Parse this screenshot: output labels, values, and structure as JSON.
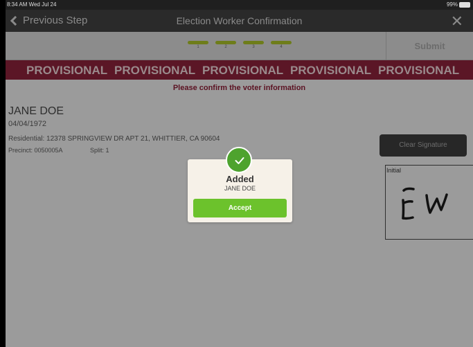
{
  "status_bar": {
    "time": "8:34 AM  Wed Jul 24",
    "battery": "99%"
  },
  "nav": {
    "back_label": "Previous Step",
    "title": "Election Worker Confirmation",
    "close_glyph": "✕"
  },
  "steps": [
    {
      "number": "1",
      "completed": true
    },
    {
      "number": "2",
      "completed": true
    },
    {
      "number": "3",
      "completed": true
    },
    {
      "number": "4",
      "completed": true
    }
  ],
  "submit_label": "Submit",
  "provisional_banner": [
    "PROVISIONAL",
    "PROVISIONAL",
    "PROVISIONAL",
    "PROVISIONAL",
    "PROVISIONAL"
  ],
  "confirm_message": "Please confirm the voter information",
  "voter": {
    "name": "JANE DOE",
    "dob": "04/04/1972",
    "residential": "Residential: 12378 SPRINGVIEW DR APT 21, WHITTIER, CA 90604",
    "precinct": "Precinct: 0050005A",
    "split": "Split: 1"
  },
  "signature": {
    "clear_label": "Clear Signature",
    "box_label": "Initial",
    "initials_drawn": "EW"
  },
  "dialog": {
    "title": "Added",
    "subtitle": "JANE DOE",
    "accept_label": "Accept",
    "icon": "check-icon"
  },
  "colors": {
    "banner": "#5b1626",
    "accept": "#6cc22c",
    "check": "#4ea32e",
    "step_complete": "#6e7d1a",
    "confirm_text": "#5b1222"
  }
}
